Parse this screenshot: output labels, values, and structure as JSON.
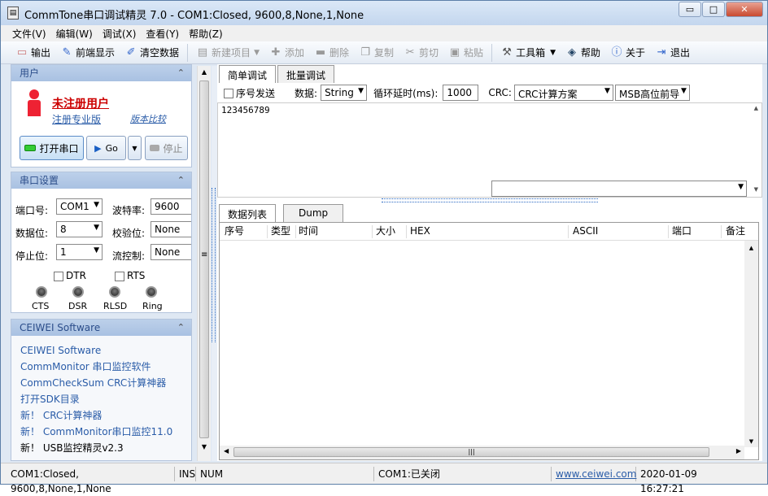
{
  "window": {
    "title": "CommTone串口调试精灵 7.0 - COM1:Closed, 9600,8,None,1,None"
  },
  "menu": [
    "文件(V)",
    "编辑(W)",
    "调试(X)",
    "查看(Y)",
    "帮助(Z)"
  ],
  "toolbar": {
    "output": "输出",
    "front_display": "前端显示",
    "clear_data": "清空数据",
    "new_item": "新建项目",
    "add": "添加",
    "delete": "删除",
    "copy": "复制",
    "cut": "剪切",
    "paste": "粘贴",
    "toolbox": "工具箱",
    "help": "帮助",
    "about": "关于",
    "exit": "退出"
  },
  "user_panel": {
    "header": "用户",
    "unregistered": "未注册用户",
    "register_pro": "注册专业版",
    "version_compare": "版本比较",
    "open_port": "打开串口",
    "go": "Go",
    "stop": "停止"
  },
  "serial_panel": {
    "header": "串口设置",
    "port_label": "端口号:",
    "port_value": "COM1",
    "baud_label": "波特率:",
    "baud_value": "9600",
    "databits_label": "数据位:",
    "databits_value": "8",
    "parity_label": "校验位:",
    "parity_value": "None",
    "stopbits_label": "停止位:",
    "stopbits_value": "1",
    "flow_label": "流控制:",
    "flow_value": "None",
    "dtr": "DTR",
    "rts": "RTS",
    "leds": [
      "CTS",
      "DSR",
      "RLSD",
      "Ring"
    ]
  },
  "links_panel": {
    "header": "CEIWEI Software",
    "links": [
      "CEIWEI Software",
      "CommMonitor 串口监控软件",
      "CommCheckSum CRC计算神器",
      "打开SDK目录",
      "新！ CRC计算神器",
      "新！ CommMonitor串口监控11.0",
      "新！ USB监控精灵v2.3"
    ]
  },
  "send_tabs": [
    "简单调试",
    "批量调试"
  ],
  "options": {
    "seq_send": "序号发送",
    "data_label": "数据:",
    "data_value": "String",
    "loop_label": "循环延时(ms):",
    "loop_value": "1000",
    "crc_label": "CRC:",
    "crc_value": "CRC计算方案",
    "msb_value": "MSB高位前导"
  },
  "send_text": "123456789",
  "data_tabs": [
    "数据列表",
    "Dump"
  ],
  "table_headers": [
    "序号",
    "类型",
    "时间",
    "大小",
    "HEX",
    "ASCII",
    "端口",
    "备注"
  ],
  "status": {
    "conn": "COM1:Closed, 9600,8,None,1,None",
    "ins": "INS",
    "num": "NUM",
    "state": "COM1:已关闭",
    "url": "www.ceiwei.com",
    "datetime": "2020-01-09 16:27:21"
  }
}
